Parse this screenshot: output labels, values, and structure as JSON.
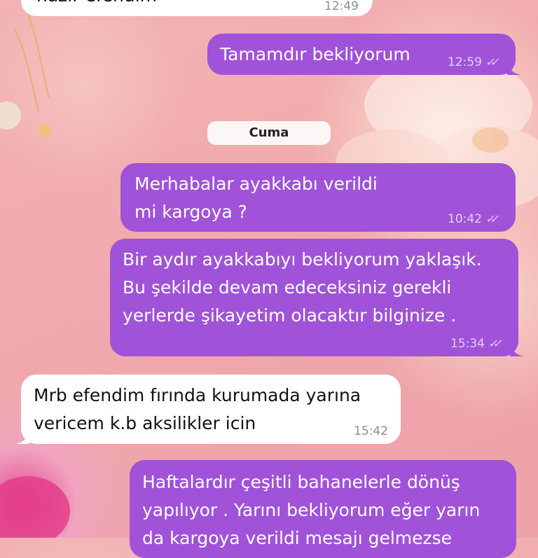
{
  "chat": {
    "day_separator": "Cuma",
    "messages": [
      {
        "direction": "in",
        "text": "hazır efendim",
        "time": "12:49"
      },
      {
        "direction": "out",
        "text": "Tamamdır bekliyorum",
        "time": "12:59",
        "status_icon": "double-check-icon"
      },
      {
        "direction": "out",
        "text": "Merhabalar ayakkabı verildi mi kargoya ?",
        "time": "10:42",
        "status_icon": "double-check-icon"
      },
      {
        "direction": "out",
        "text": "Bir aydır ayakkabıyı bekliyorum yaklaşık. Bu şekilde devam edeceksiniz gerekli yerlerde şikayetim olacaktır bilginize .",
        "time": "15:34",
        "status_icon": "double-check-icon"
      },
      {
        "direction": "in",
        "text": "Mrb efendim fırında kurumada yarına vericem  k.b aksilikler icin",
        "time": "15:42"
      },
      {
        "direction": "out",
        "text": "Haftalardır çeşitli bahanelerle dönüş yapılıyor . Yarını bekliyorum eğer yarın da kargoya verildi mesajı gelmezse"
      }
    ]
  },
  "colors": {
    "outgoing_bubble": "#a052d9",
    "incoming_bubble": "#ffffff",
    "wallpaper": "#f1a9ad"
  }
}
